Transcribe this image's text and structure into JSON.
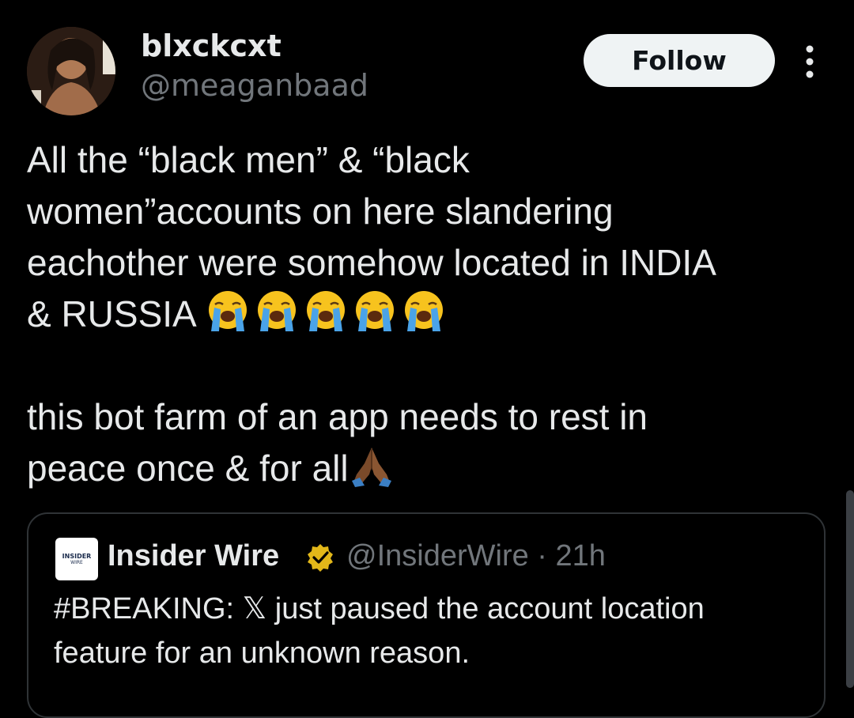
{
  "author": {
    "display_name": "blxckcxt",
    "handle": "@meaganbaad",
    "avatar_icon": "profile-photo"
  },
  "actions": {
    "follow_label": "Follow",
    "more_icon": "more-vertical-icon"
  },
  "tweet": {
    "line1": "All the “black men” & “black",
    "line2": "women”accounts on here slandering",
    "line3": "eachother were somehow located in INDIA",
    "line4_text": "& RUSSIA ",
    "crying_emoji_count": 5,
    "line5": "this bot farm of an app needs to rest in",
    "line6_text": "peace once & for all",
    "folded_hands_emoji": "folded-hands-icon"
  },
  "quoted_tweet": {
    "logo_line1": "INSIDER",
    "logo_line2": "WIRE",
    "name": "Insider Wire",
    "verified_icon": "gold-verified-badge-icon",
    "meta": "@InsiderWire · 21h",
    "text_line1": "#BREAKING: 𝕏 just paused the account location",
    "text_line2": "feature for an unknown reason."
  },
  "colors": {
    "background": "#000000",
    "primary_text": "#e7e9ea",
    "secondary_text": "#71767b",
    "follow_bg": "#eff3f4",
    "border": "#2f3336",
    "verified_gold": "#e2b719"
  }
}
